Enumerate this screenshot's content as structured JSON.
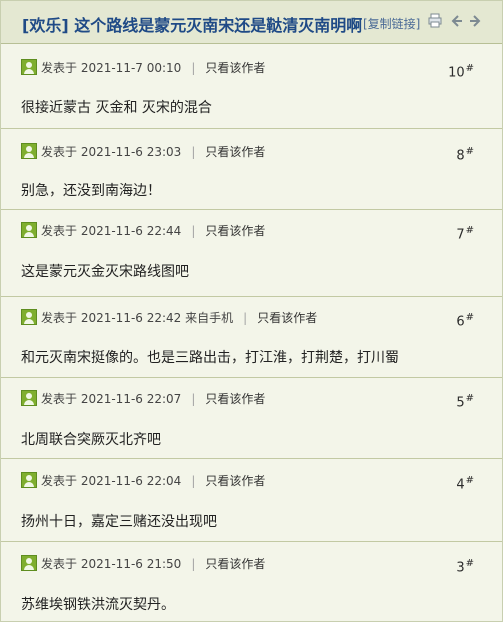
{
  "thread": {
    "title": "[欢乐] 这个路线是蒙元灭南宋还是鞑清灭南明啊",
    "copy_link": "[复制链接]"
  },
  "icons": [
    "print-icon",
    "prev-arrow-icon",
    "next-arrow-icon"
  ],
  "posts": [
    {
      "meta": "发表于 2021-11-7 00:10",
      "mobile": "",
      "author_link": "只看该作者",
      "floor": "10",
      "content": "很接近蒙古 灭金和 灭宋的混合"
    },
    {
      "meta": "发表于 2021-11-6 23:03",
      "mobile": "",
      "author_link": "只看该作者",
      "floor": "8",
      "content": "别急，还没到南海边！"
    },
    {
      "meta": "发表于 2021-11-6 22:44",
      "mobile": "",
      "author_link": "只看该作者",
      "floor": "7",
      "content": "这是蒙元灭金灭宋路线图吧"
    },
    {
      "meta": "发表于 2021-11-6 22:42",
      "mobile": "来自手机",
      "author_link": "只看该作者",
      "floor": "6",
      "content": "和元灭南宋挺像的。也是三路出击，打江淮，打荆楚，打川蜀"
    },
    {
      "meta": "发表于 2021-11-6 22:07",
      "mobile": "",
      "author_link": "只看该作者",
      "floor": "5",
      "content": "北周联合突厥灭北齐吧"
    },
    {
      "meta": "发表于 2021-11-6 22:04",
      "mobile": "",
      "author_link": "只看该作者",
      "floor": "4",
      "content": "扬州十日，嘉定三赌还没出现吧"
    },
    {
      "meta": "发表于 2021-11-6 21:50",
      "mobile": "",
      "author_link": "只看该作者",
      "floor": "3",
      "content": "苏维埃钢铁洪流灭契丹。"
    }
  ]
}
